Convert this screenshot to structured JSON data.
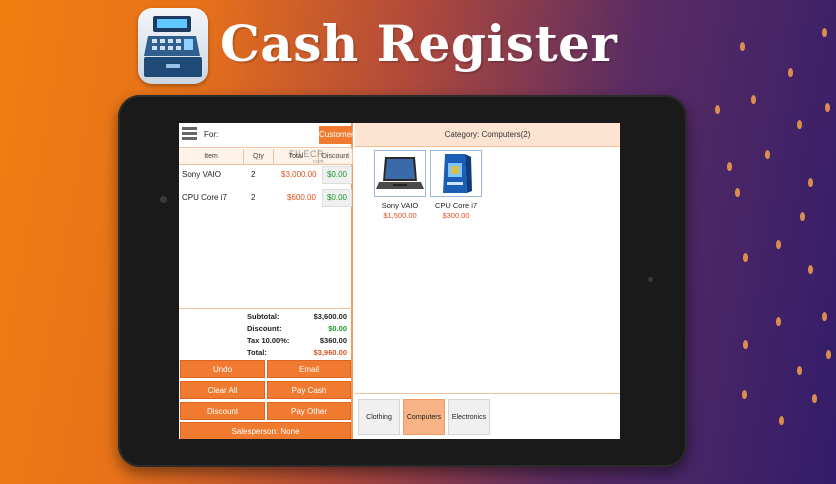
{
  "banner": {
    "title": "Cash Register",
    "app_icon": "cash-register-app-icon"
  },
  "order": {
    "for_label": "For:",
    "customer_button": "Customer",
    "columns": [
      "Item",
      "Qty",
      "Total",
      "Discount"
    ],
    "items": [
      {
        "name": "Sony VAIO",
        "qty": "2",
        "total": "$3,000.00",
        "discount": "$0.00"
      },
      {
        "name": "CPU Core i7",
        "qty": "2",
        "total": "$600.00",
        "discount": "$0.00"
      }
    ],
    "totals": {
      "subtotal_label": "Subtotal:",
      "subtotal": "$3,600.00",
      "discount_label": "Discount:",
      "discount": "$0.00",
      "tax_label": "Tax 10.00%:",
      "tax": "$360.00",
      "total_label": "Total:",
      "total": "$3,960.00"
    },
    "buttons": {
      "undo": "Undo",
      "email": "Email",
      "clear_all": "Clear All",
      "pay_cash": "Pay Cash",
      "discount": "Discount",
      "pay_other": "Pay Other",
      "salesperson": "Salesperson: None"
    }
  },
  "catalog": {
    "category_header": "Category: Computers(2)",
    "products": [
      {
        "name": "Sony VAIO",
        "price": "$1,500.00",
        "icon": "laptop-icon"
      },
      {
        "name": "CPU Core i7",
        "price": "$300.00",
        "icon": "cpu-box-icon"
      }
    ],
    "categories": [
      {
        "label": "Clothing",
        "active": false
      },
      {
        "label": "Computers",
        "active": true
      },
      {
        "label": "Electronics",
        "active": false
      }
    ]
  },
  "watermark": {
    "text": "FILECR",
    "sub": ".com"
  },
  "colors": {
    "accent": "#f07a2f",
    "price_red": "#e0501a",
    "discount_green": "#1a9c2a",
    "header_bg": "#fde3d2"
  }
}
